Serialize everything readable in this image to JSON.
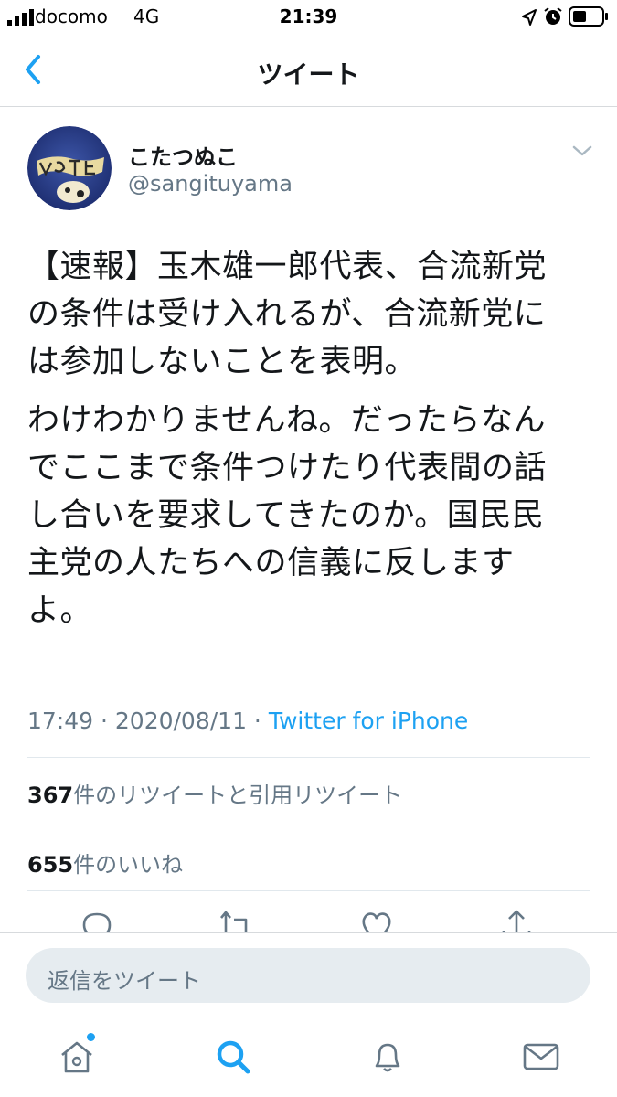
{
  "status_bar": {
    "carrier": "docomo",
    "network": "4G",
    "time": "21:39"
  },
  "header": {
    "title": "ツイート"
  },
  "tweet": {
    "display_name": "こたつぬこ",
    "handle": "@sangituyama",
    "paragraphs": [
      "【速報】玉木雄一郎代表、合流新党の条件は受け入れるが、合流新党には参加しないことを表明。",
      "わけわかりませんね。だったらなんでここまで条件つけたり代表間の話し合いを要求してきたのか。国民民主党の人たちへの信義に反しますよ。"
    ],
    "time": "17:49",
    "separator": " · ",
    "date": "2020/08/11",
    "source": "Twitter for iPhone",
    "retweets_count": "367",
    "retweets_label": "件のリツイートと引用リツイート",
    "likes_count": "655",
    "likes_label": "件のいいね"
  },
  "actions": [
    "reply-icon",
    "retweet-icon",
    "like-icon",
    "share-icon"
  ],
  "reply_bar": {
    "placeholder": "返信をツイート"
  },
  "tab_bar": [
    "home-icon",
    "search-icon",
    "notifications-icon",
    "messages-icon"
  ],
  "colors": {
    "accent": "#1da1f2",
    "text": "#14171a",
    "secondary": "#657786",
    "divider": "#e1e8ed"
  }
}
